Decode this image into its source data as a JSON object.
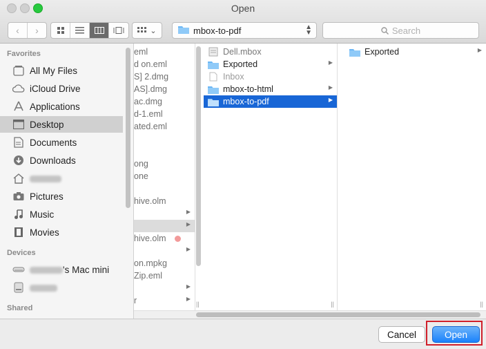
{
  "window": {
    "title": "Open"
  },
  "toolbar": {
    "location": "mbox-to-pdf",
    "search_placeholder": "Search"
  },
  "sidebar": {
    "favorites_heading": "Favorites",
    "favorites": [
      {
        "label": "All My Files",
        "icon": "all-files-icon"
      },
      {
        "label": "iCloud Drive",
        "icon": "cloud-icon"
      },
      {
        "label": "Applications",
        "icon": "applications-icon"
      },
      {
        "label": "Desktop",
        "icon": "desktop-icon",
        "selected": true
      },
      {
        "label": "Documents",
        "icon": "documents-icon"
      },
      {
        "label": "Downloads",
        "icon": "downloads-icon"
      },
      {
        "label": "",
        "icon": "home-icon"
      },
      {
        "label": "Pictures",
        "icon": "camera-icon"
      },
      {
        "label": "Music",
        "icon": "music-icon"
      },
      {
        "label": "Movies",
        "icon": "movies-icon"
      }
    ],
    "devices_heading": "Devices",
    "devices": [
      {
        "label": "'s Mac mini",
        "icon": "computer-icon"
      },
      {
        "label": "",
        "icon": "disk-icon"
      }
    ],
    "shared_heading": "Shared"
  },
  "column1": [
    {
      "label": "eml"
    },
    {
      "label": "d on.eml"
    },
    {
      "label": "S] 2.dmg"
    },
    {
      "label": "AS].dmg"
    },
    {
      "label": "ac.dmg"
    },
    {
      "label": "d-1.eml"
    },
    {
      "label": "ated.eml"
    },
    {
      "label": ""
    },
    {
      "label": "ong"
    },
    {
      "label": "one"
    },
    {
      "label": ""
    },
    {
      "label": "hive.olm"
    },
    {
      "label": ""
    },
    {
      "label": "",
      "selected": true
    },
    {
      "label": "hive.olm"
    },
    {
      "label": ""
    },
    {
      "label": "on.mpkg"
    },
    {
      "label": "Zip.eml"
    },
    {
      "label": ""
    },
    {
      "label": "r"
    }
  ],
  "column2": [
    {
      "label": "Dell.mbox",
      "icon": "mbox-file-icon",
      "dim": true
    },
    {
      "label": "Exported",
      "icon": "folder-icon",
      "has_children": true
    },
    {
      "label": "Inbox",
      "icon": "document-icon",
      "dim": true
    },
    {
      "label": "mbox-to-html",
      "icon": "folder-icon",
      "has_children": true
    },
    {
      "label": "mbox-to-pdf",
      "icon": "folder-icon",
      "has_children": true,
      "selected": true
    }
  ],
  "column3": [
    {
      "label": "Exported",
      "icon": "folder-icon",
      "has_children": true
    }
  ],
  "buttons": {
    "cancel": "Cancel",
    "open": "Open"
  },
  "colors": {
    "selection": "#1866d6",
    "accent": "#1a82fb",
    "highlight_box": "#d01f2a"
  }
}
